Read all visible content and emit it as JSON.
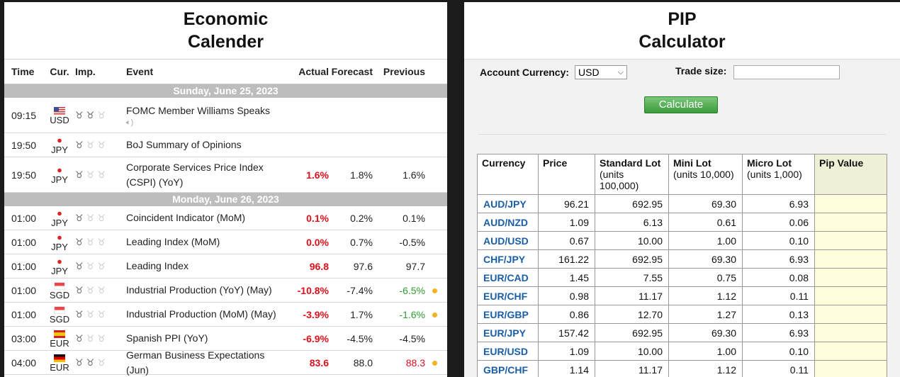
{
  "calendar": {
    "title_line1": "Economic",
    "title_line2": "Calender",
    "headers": {
      "time": "Time",
      "cur": "Cur.",
      "imp": "Imp.",
      "event": "Event",
      "actual": "Actual",
      "forecast": "Forecast",
      "previous": "Previous"
    },
    "sections": [
      {
        "date": "Sunday, June 25, 2023",
        "rows": [
          {
            "time": "09:15",
            "flag": "us",
            "cur": "USD",
            "imp": 2,
            "event": "FOMC Member Williams Speaks",
            "speaker": true,
            "actual": "",
            "forecast": "",
            "previous": "",
            "prev_color": "",
            "dot": false
          },
          {
            "time": "19:50",
            "flag": "jp",
            "cur": "JPY",
            "imp": 1,
            "event": "BoJ Summary of Opinions",
            "speaker": false,
            "actual": "",
            "forecast": "",
            "previous": "",
            "prev_color": "",
            "dot": false
          },
          {
            "time": "19:50",
            "flag": "jp",
            "cur": "JPY",
            "imp": 1,
            "event": "Corporate Services Price Index (CSPI) (YoY)",
            "speaker": false,
            "actual": "1.6%",
            "forecast": "1.8%",
            "previous": "1.6%",
            "prev_color": "",
            "dot": false
          }
        ]
      },
      {
        "date": "Monday, June 26, 2023",
        "rows": [
          {
            "time": "01:00",
            "flag": "jp",
            "cur": "JPY",
            "imp": 1,
            "event": "Coincident Indicator (MoM)",
            "speaker": false,
            "actual": "0.1%",
            "forecast": "0.2%",
            "previous": "0.1%",
            "prev_color": "",
            "dot": false
          },
          {
            "time": "01:00",
            "flag": "jp",
            "cur": "JPY",
            "imp": 1,
            "event": "Leading Index (MoM)",
            "speaker": false,
            "actual": "0.0%",
            "forecast": "0.7%",
            "previous": "-0.5%",
            "prev_color": "",
            "dot": false
          },
          {
            "time": "01:00",
            "flag": "jp",
            "cur": "JPY",
            "imp": 1,
            "event": "Leading Index",
            "speaker": false,
            "actual": "96.8",
            "forecast": "97.6",
            "previous": "97.7",
            "prev_color": "",
            "dot": false
          },
          {
            "time": "01:00",
            "flag": "sg",
            "cur": "SGD",
            "imp": 1,
            "event": "Industrial Production (YoY) (May)",
            "speaker": false,
            "actual": "-10.8%",
            "forecast": "-7.4%",
            "previous": "-6.5%",
            "prev_color": "green",
            "dot": true
          },
          {
            "time": "01:00",
            "flag": "sg",
            "cur": "SGD",
            "imp": 1,
            "event": "Industrial Production (MoM) (May)",
            "speaker": false,
            "actual": "-3.9%",
            "forecast": "1.7%",
            "previous": "-1.6%",
            "prev_color": "green",
            "dot": true
          },
          {
            "time": "03:00",
            "flag": "es",
            "cur": "EUR",
            "imp": 1,
            "event": "Spanish PPI (YoY)",
            "speaker": false,
            "actual": "-6.9%",
            "forecast": "-4.5%",
            "previous": "-4.5%",
            "prev_color": "",
            "dot": false
          },
          {
            "time": "04:00",
            "flag": "de",
            "cur": "EUR",
            "imp": 2,
            "event": "German Business Expectations (Jun)",
            "speaker": false,
            "actual": "83.6",
            "forecast": "88.0",
            "previous": "88.3",
            "prev_color": "red",
            "dot": true
          }
        ]
      }
    ]
  },
  "pip": {
    "title_line1": "PIP",
    "title_line2": "Calculator",
    "account_currency_label": "Account Currency:",
    "account_currency_value": "USD",
    "trade_size_label": "Trade size:",
    "trade_size_value": "",
    "calculate_label": "Calculate",
    "headers": {
      "currency": "Currency",
      "price": "Price",
      "standard": "Standard Lot",
      "standard_units": "(units 100,000)",
      "mini": "Mini Lot",
      "mini_units": "(units 10,000)",
      "micro": "Micro Lot",
      "micro_units": "(units 1,000)",
      "pip_value": "Pip Value"
    },
    "rows": [
      {
        "pair": "AUD/JPY",
        "price": "96.21",
        "standard": "692.95",
        "mini": "69.30",
        "micro": "6.93"
      },
      {
        "pair": "AUD/NZD",
        "price": "1.09",
        "standard": "6.13",
        "mini": "0.61",
        "micro": "0.06"
      },
      {
        "pair": "AUD/USD",
        "price": "0.67",
        "standard": "10.00",
        "mini": "1.00",
        "micro": "0.10"
      },
      {
        "pair": "CHF/JPY",
        "price": "161.22",
        "standard": "692.95",
        "mini": "69.30",
        "micro": "6.93"
      },
      {
        "pair": "EUR/CAD",
        "price": "1.45",
        "standard": "7.55",
        "mini": "0.75",
        "micro": "0.08"
      },
      {
        "pair": "EUR/CHF",
        "price": "0.98",
        "standard": "11.17",
        "mini": "1.12",
        "micro": "0.11"
      },
      {
        "pair": "EUR/GBP",
        "price": "0.86",
        "standard": "12.70",
        "mini": "1.27",
        "micro": "0.13"
      },
      {
        "pair": "EUR/JPY",
        "price": "157.42",
        "standard": "692.95",
        "mini": "69.30",
        "micro": "6.93"
      },
      {
        "pair": "EUR/USD",
        "price": "1.09",
        "standard": "10.00",
        "mini": "1.00",
        "micro": "0.10"
      },
      {
        "pair": "GBP/CHF",
        "price": "1.14",
        "standard": "11.17",
        "mini": "1.12",
        "micro": "0.11"
      }
    ]
  }
}
